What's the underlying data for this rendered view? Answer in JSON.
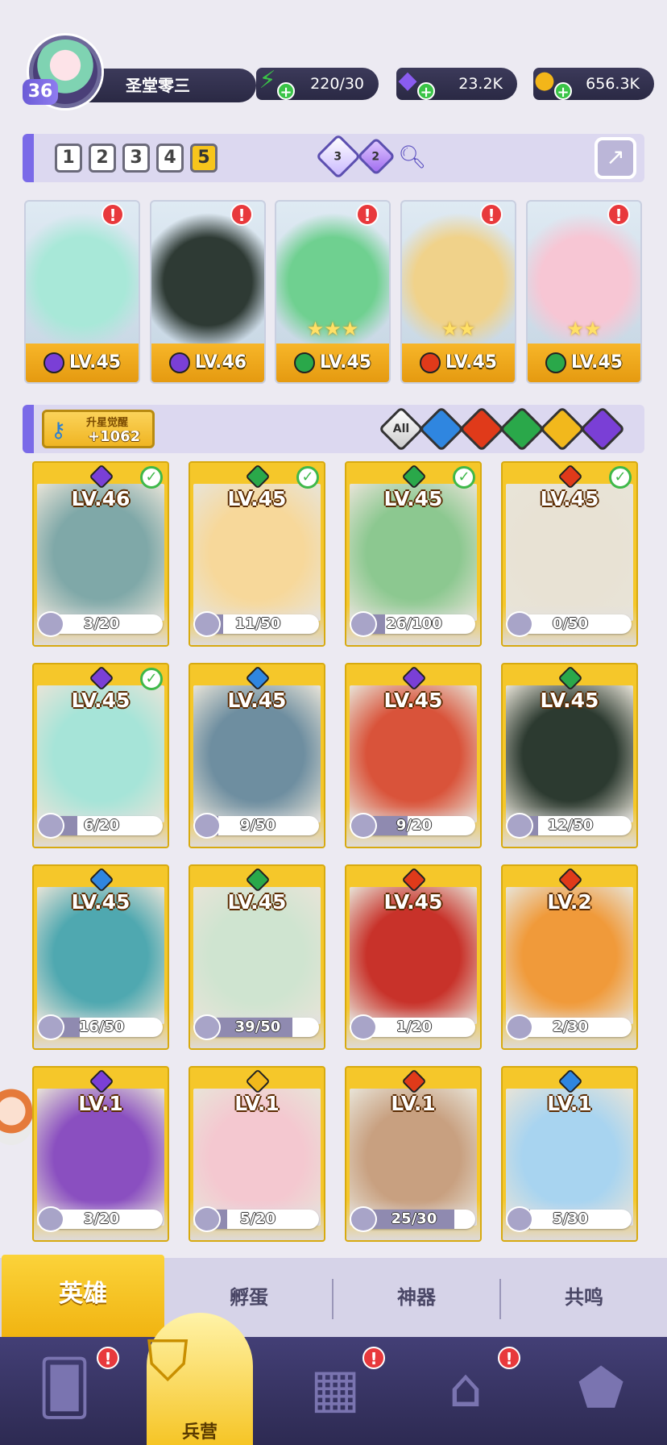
{
  "profile": {
    "level": "36",
    "name": "圣堂零三"
  },
  "resources": [
    {
      "name": "energy",
      "icon": "lightning-icon",
      "value": "220/30",
      "color": "#3ac447"
    },
    {
      "name": "gems",
      "icon": "diamond-icon",
      "value": "23.2K",
      "color": "#8a5cf0"
    },
    {
      "name": "coins",
      "icon": "coin-icon",
      "value": "656.3K",
      "color": "#f3b619"
    }
  ],
  "team": {
    "slots": [
      "1",
      "2",
      "3",
      "4",
      "5"
    ],
    "active_slot": "5",
    "gems": [
      {
        "count": "3",
        "color": "#c9b8ff"
      },
      {
        "count": "2",
        "color": "#a06cf0"
      }
    ]
  },
  "featured": [
    {
      "level": "LV.45",
      "element": "#7a3fd6",
      "stars": "",
      "art": "#a8e8d8"
    },
    {
      "level": "LV.46",
      "element": "#7a3fd6",
      "stars": "",
      "art": "#2e3a34"
    },
    {
      "level": "LV.45",
      "element": "#2aa84a",
      "stars": "★★★",
      "art": "#6fd090"
    },
    {
      "level": "LV.45",
      "element": "#e03a1a",
      "stars": "★★",
      "art": "#f0d28a"
    },
    {
      "level": "LV.45",
      "element": "#2aa84a",
      "stars": "★★",
      "art": "#f7c6d4"
    }
  ],
  "filter": {
    "awaken_label": "升星觉醒",
    "awaken_count": "+1062",
    "elements": [
      {
        "label": "All",
        "color": "#ffffff"
      },
      {
        "label": "",
        "color": "#2f86e0"
      },
      {
        "label": "",
        "color": "#e03a1a"
      },
      {
        "label": "",
        "color": "#2aa84a"
      },
      {
        "label": "",
        "color": "#f2b81c"
      },
      {
        "label": "",
        "color": "#7a3fd6"
      }
    ]
  },
  "heroes": [
    {
      "level": "LV.46",
      "element": "#7a3fd6",
      "shards": "3/20",
      "progress": 0.15,
      "checked": true,
      "art": "#7fa8a8"
    },
    {
      "level": "LV.45",
      "element": "#2aa84a",
      "shards": "11/50",
      "progress": 0.22,
      "checked": true,
      "art": "#f7d89a"
    },
    {
      "level": "LV.45",
      "element": "#2aa84a",
      "shards": "26/100",
      "progress": 0.26,
      "checked": true,
      "art": "#8cc890"
    },
    {
      "level": "LV.45",
      "element": "#e03a1a",
      "shards": "0/50",
      "progress": 0.0,
      "checked": true,
      "art": "#e8e2d4"
    },
    {
      "level": "LV.45",
      "element": "#7a3fd6",
      "shards": "6/20",
      "progress": 0.3,
      "checked": true,
      "art": "#a6e4d8"
    },
    {
      "level": "LV.45",
      "element": "#2f86e0",
      "shards": "9/50",
      "progress": 0.18,
      "checked": false,
      "art": "#6e8ea0"
    },
    {
      "level": "LV.45",
      "element": "#7a3fd6",
      "shards": "9/20",
      "progress": 0.45,
      "checked": false,
      "art": "#d9533a"
    },
    {
      "level": "LV.45",
      "element": "#2aa84a",
      "shards": "12/50",
      "progress": 0.24,
      "checked": false,
      "art": "#2c3a30"
    },
    {
      "level": "LV.45",
      "element": "#2f86e0",
      "shards": "16/50",
      "progress": 0.32,
      "checked": false,
      "art": "#4fa8b0"
    },
    {
      "level": "LV.45",
      "element": "#2aa84a",
      "shards": "39/50",
      "progress": 0.78,
      "checked": false,
      "art": "#cfe4d0"
    },
    {
      "level": "LV.45",
      "element": "#e03a1a",
      "shards": "1/20",
      "progress": 0.05,
      "checked": false,
      "art": "#c8322a"
    },
    {
      "level": "LV.2",
      "element": "#e03a1a",
      "shards": "2/30",
      "progress": 0.07,
      "checked": false,
      "art": "#f09a3a"
    },
    {
      "level": "LV.1",
      "element": "#7a3fd6",
      "shards": "3/20",
      "progress": 0.15,
      "checked": false,
      "art": "#8a4fc0"
    },
    {
      "level": "LV.1",
      "element": "#f2b81c",
      "shards": "5/20",
      "progress": 0.25,
      "checked": false,
      "art": "#f4c8d0"
    },
    {
      "level": "LV.1",
      "element": "#e03a1a",
      "shards": "25/30",
      "progress": 0.83,
      "checked": false,
      "art": "#c8a080"
    },
    {
      "level": "LV.1",
      "element": "#2f86e0",
      "shards": "5/30",
      "progress": 0.17,
      "checked": false,
      "art": "#a8d4f0"
    }
  ],
  "tabs": [
    "英雄",
    "孵蛋",
    "神器",
    "共鸣"
  ],
  "nav": {
    "barracks_label": "兵营"
  }
}
